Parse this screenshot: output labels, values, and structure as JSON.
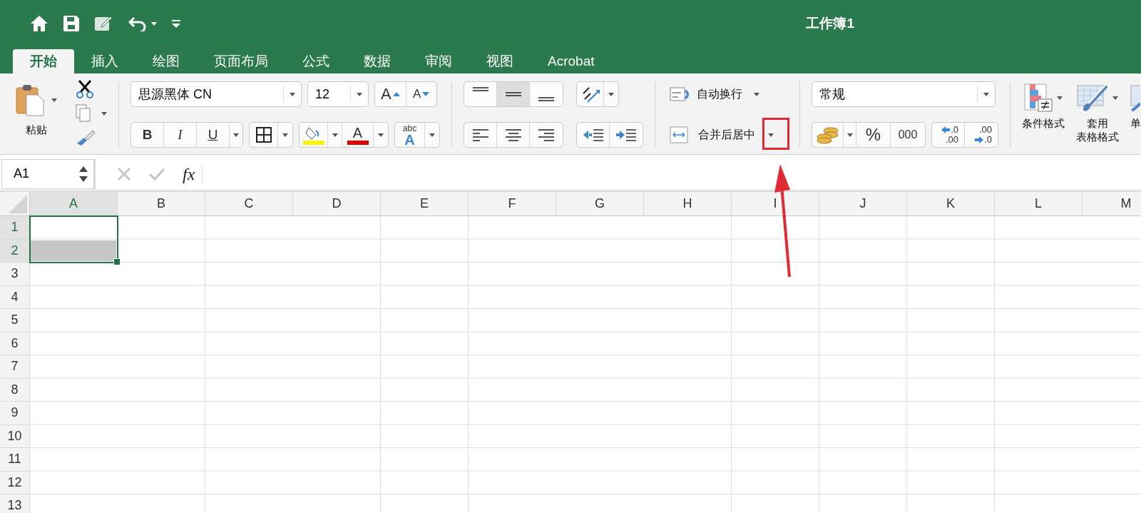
{
  "window": {
    "title": "工作簿1"
  },
  "tabs": [
    {
      "label": "开始",
      "selected": true
    },
    {
      "label": "插入",
      "selected": false
    },
    {
      "label": "绘图",
      "selected": false
    },
    {
      "label": "页面布局",
      "selected": false
    },
    {
      "label": "公式",
      "selected": false
    },
    {
      "label": "数据",
      "selected": false
    },
    {
      "label": "审阅",
      "selected": false
    },
    {
      "label": "视图",
      "selected": false
    },
    {
      "label": "Acrobat",
      "selected": false
    }
  ],
  "ribbon": {
    "paste_label": "粘贴",
    "font_name": "思源黑体 CN",
    "font_size": "12",
    "size_buttons": [
      "A",
      "A"
    ],
    "style_buttons": [
      "B",
      "I",
      "U"
    ],
    "font_color_letter": "A",
    "text_style": [
      "abc",
      "A"
    ],
    "vertical_alignment": [
      {
        "kind": "top",
        "selected": false
      },
      {
        "kind": "middle",
        "selected": true
      },
      {
        "kind": "bottom",
        "selected": false
      }
    ],
    "wrap_text": "自动换行",
    "merge_center": "合并后居中",
    "number_format": "常规",
    "percent": "%",
    "comma": "000",
    "decimal_buttons": [
      [
        ".0",
        ".00"
      ],
      [
        ".00",
        ".0"
      ]
    ],
    "conditional_format": "条件格式",
    "format_as_table": [
      "套用",
      "表格格式"
    ],
    "cell_styles": "单"
  },
  "formula_bar": {
    "name_box": "A1",
    "fx": "fx"
  },
  "sheet": {
    "columns": [
      {
        "label": "A",
        "selected": true
      },
      {
        "label": "B",
        "selected": false
      },
      {
        "label": "C",
        "selected": false
      },
      {
        "label": "D",
        "selected": false
      },
      {
        "label": "E",
        "selected": false
      },
      {
        "label": "F",
        "selected": false
      },
      {
        "label": "G",
        "selected": false
      },
      {
        "label": "H",
        "selected": false
      },
      {
        "label": "I",
        "selected": false
      },
      {
        "label": "J",
        "selected": false
      },
      {
        "label": "K",
        "selected": false
      },
      {
        "label": "L",
        "selected": false
      },
      {
        "label": "M",
        "selected": false
      }
    ],
    "rows": [
      {
        "label": "1",
        "selected": true
      },
      {
        "label": "2",
        "selected": true
      },
      {
        "label": "3",
        "selected": false
      },
      {
        "label": "4",
        "selected": false
      },
      {
        "label": "5",
        "selected": false
      },
      {
        "label": "6",
        "selected": false
      },
      {
        "label": "7",
        "selected": false
      },
      {
        "label": "8",
        "selected": false
      },
      {
        "label": "9",
        "selected": false
      },
      {
        "label": "10",
        "selected": false
      },
      {
        "label": "11",
        "selected": false
      },
      {
        "label": "12",
        "selected": false
      },
      {
        "label": "13",
        "selected": false
      }
    ]
  },
  "annotation": {
    "highlight_box": true,
    "arrow": true
  }
}
